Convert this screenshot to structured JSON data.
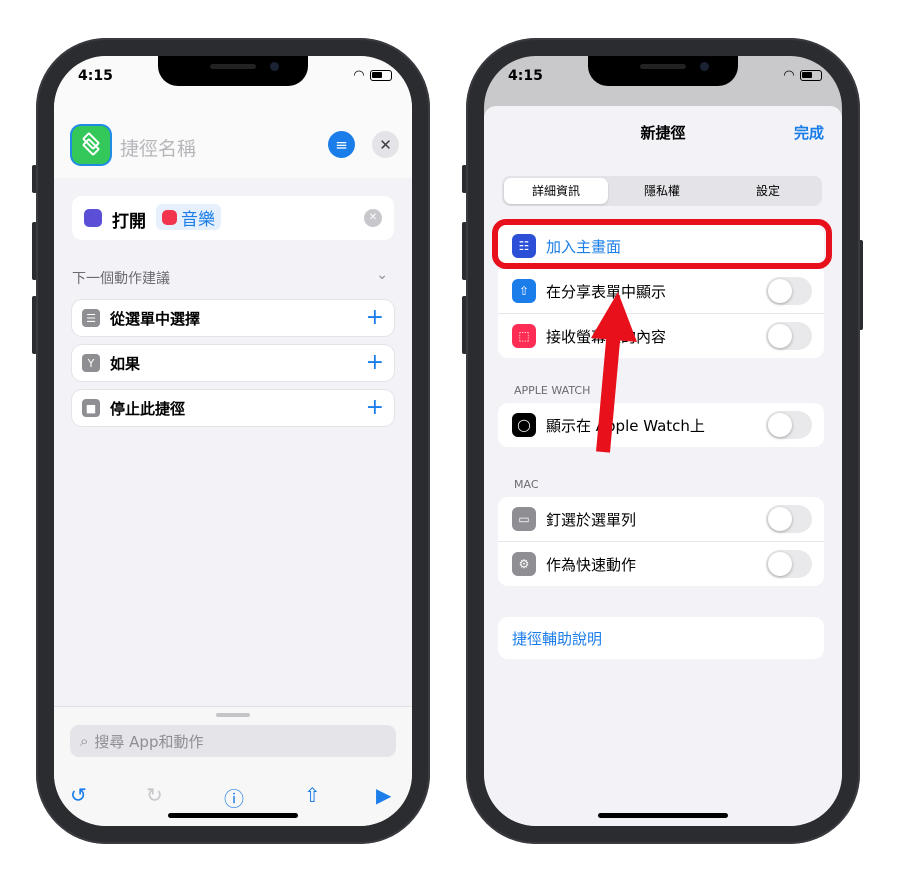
{
  "left_phone": {
    "status_time": "4:15",
    "shortcut_name_placeholder": "捷徑名稱",
    "action": {
      "verb": "打開",
      "app": "音樂"
    },
    "suggestions_header": "下一個動作建議",
    "suggestions": [
      {
        "label": "從選單中選擇",
        "icon": "menu-icon"
      },
      {
        "label": "如果",
        "icon": "branch-icon"
      },
      {
        "label": "停止此捷徑",
        "icon": "stop-icon"
      }
    ],
    "search_placeholder": "搜尋 App和動作",
    "toolbar": [
      "undo-icon",
      "redo-icon",
      "info-icon",
      "share-icon",
      "play-icon"
    ]
  },
  "right_phone": {
    "status_time": "4:15",
    "sheet_title": "新捷徑",
    "done_label": "完成",
    "tabs": [
      "詳細資訊",
      "隱私權",
      "設定"
    ],
    "selected_tab": "詳細資訊",
    "rows_main": [
      {
        "label": "加入主畫面",
        "highlighted": true
      },
      {
        "label": "在分享表單中顯示",
        "toggle": false
      },
      {
        "label": "接收螢幕上的內容",
        "toggle": false
      }
    ],
    "section_watch": "APPLE WATCH",
    "row_watch": {
      "label": "顯示在 Apple Watch上",
      "toggle": false
    },
    "section_mac": "MAC",
    "rows_mac": [
      {
        "label": "釘選於選單列",
        "toggle": false
      },
      {
        "label": "作為快速動作",
        "toggle": false
      }
    ],
    "help_link": "捷徑輔助說明"
  },
  "colors": {
    "accent": "#1a7de9",
    "annotation": "#e8101a",
    "green": "#34c759"
  }
}
